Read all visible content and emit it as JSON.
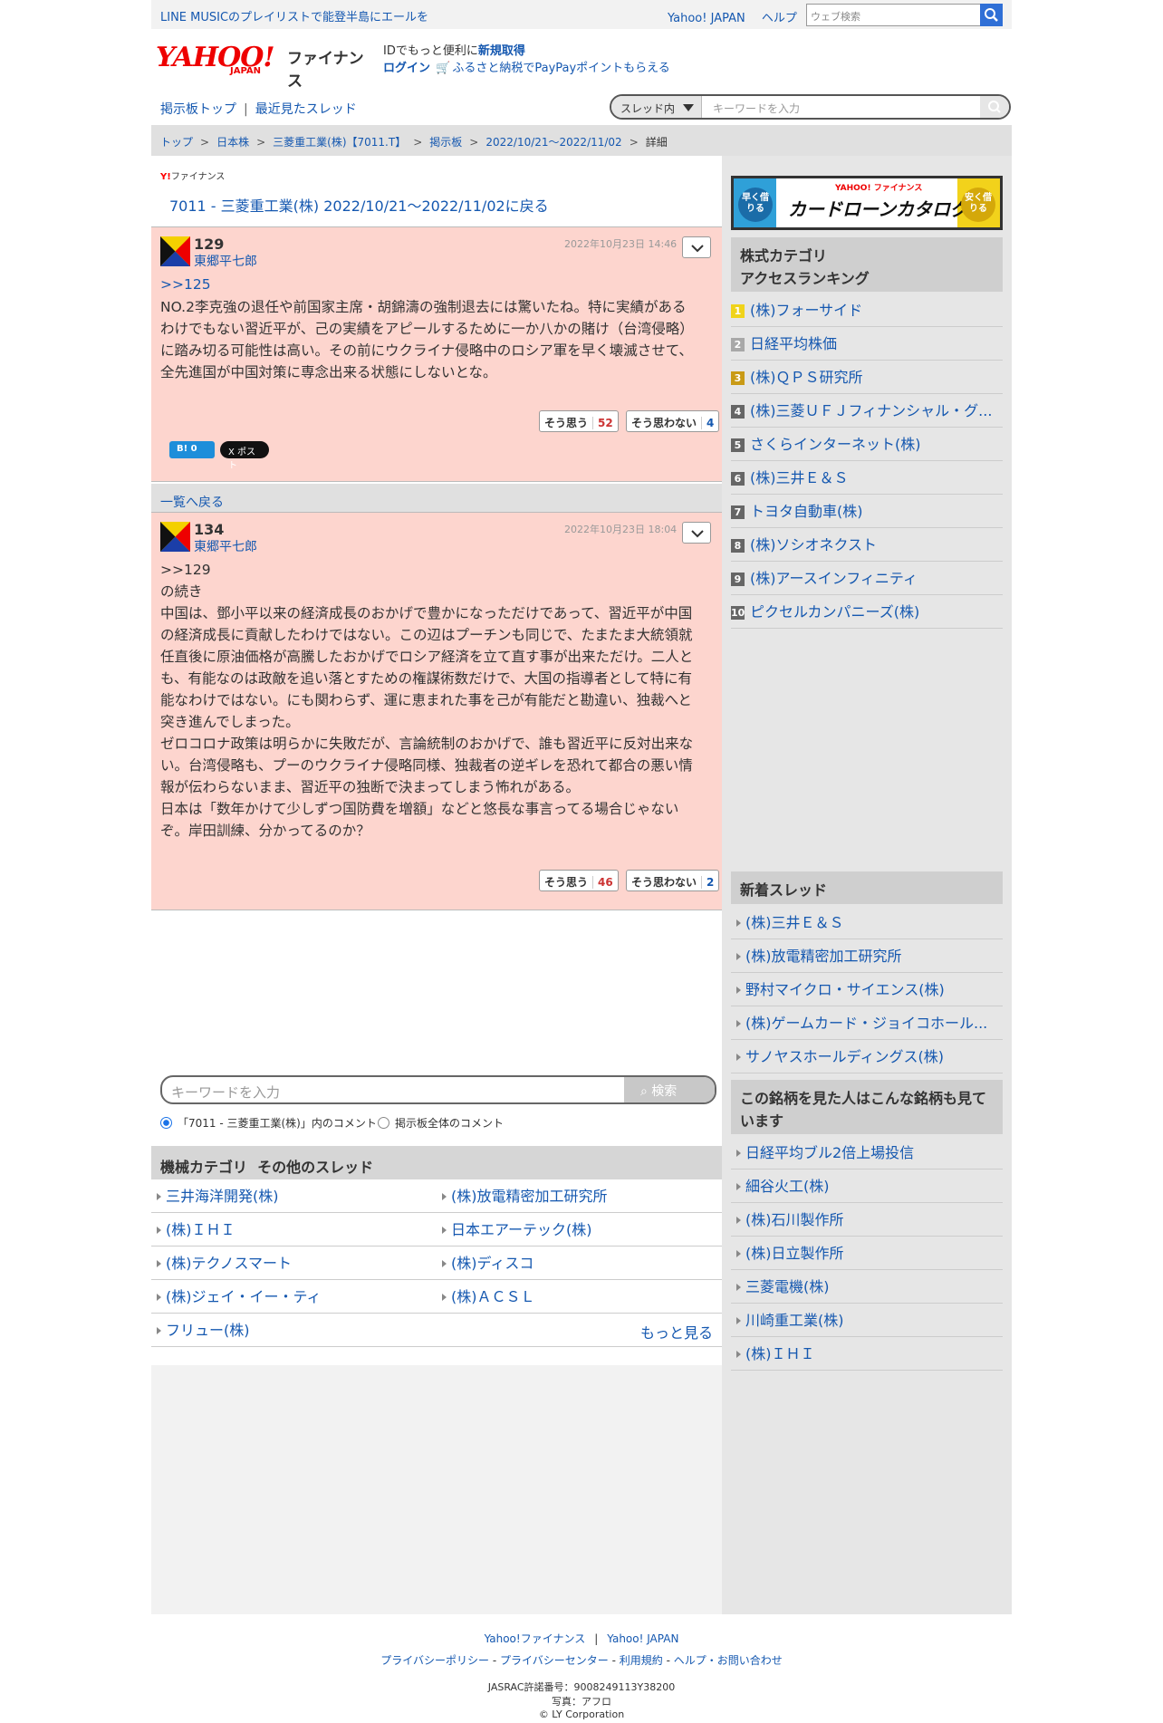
{
  "topbar": {
    "promo": "LINE MUSICのプレイリストで能登半島にエールを",
    "links": [
      "Yahoo! JAPAN",
      "ヘルプ"
    ],
    "search_placeholder": "ウェブ検索"
  },
  "header": {
    "logo_text": "YAHOO!",
    "logo_sub": "JAPAN",
    "service": "ファイナンス",
    "id_prefix": "IDでもっと便利に",
    "id_link": "新規取得",
    "login": "ログイン",
    "furusato": "ふるさと納税でPayPayポイントもらえる"
  },
  "subnav": {
    "board_top": "掲示板トップ",
    "recent": "最近見たスレッド",
    "scope": "スレッド内",
    "keyword_placeholder": "キーワードを入力"
  },
  "breadcrumb": [
    "トップ",
    "日本株",
    "三菱重工業(株)【7011.T】",
    "掲示板",
    "2022/10/21〜2022/11/02",
    "詳細"
  ],
  "thread": {
    "ylogo": "ファイナンス",
    "back_link": "7011 - 三菱重工業(株) 2022/10/21〜2022/11/02に戻る"
  },
  "posts": [
    {
      "number": "129",
      "author": "東郷平七郎",
      "date": "2022年10月23日 14:46",
      "reply": ">>125",
      "body": "NO.2李克強の退任や前国家主席・胡錦濤の強制退去には驚いたね。特に実績がある\nわけでもない習近平が、己の実績をアピールするために一か八かの賭け（台湾侵略）\nに踏み切る可能性は高い。その前にウクライナ侵略中のロシア軍を早く壊滅させて、\n全先進国が中国対策に専念出来る状態にしないとな。",
      "agree_label": "そう思う",
      "agree": "52",
      "disagree_label": "そう思わない",
      "disagree": "4",
      "hatena": "B! 0",
      "xpost": "X ポスト"
    },
    {
      "number": "134",
      "author": "東郷平七郎",
      "date": "2022年10月23日 18:04",
      "body": ">>129\nの続き\n中国は、鄧小平以来の経済成長のおかげで豊かになっただけであって、習近平が中国\nの経済成長に貢献したわけではない。この辺はプーチンも同じで、たまたま大統領就\n任直後に原油価格が高騰したおかげでロシア経済を立て直す事が出来ただけ。二人と\nも、有能なのは政敵を追い落とすための権謀術数だけで、大国の指導者として特に有\n能なわけではない。にも関わらず、運に恵まれた事を己が有能だと勘違い、独裁へと\n突き進んでしまった。\nゼロコロナ政策は明らかに失敗だが、言論統制のおかげで、誰も習近平に反対出来な\nい。台湾侵略も、プーのウクライナ侵略同様、独裁者の逆ギレを恐れて都合の悪い情\n報が伝わらないまま、習近平の独断で決まってしまう怖れがある。\n日本は「数年かけて少しずつ国防費を増額」などと悠長な事言ってる場合じゃない\nぞ。岸田訓練、分かってるのか？",
      "agree_label": "そう思う",
      "agree": "46",
      "disagree_label": "そう思わない",
      "disagree": "2"
    }
  ],
  "list_back": "一覧へ戻る",
  "bottom_search": {
    "placeholder": "キーワードを入力",
    "button": "検索",
    "radio_thread": "「7011 - 三菱重工業(株)」内のコメント",
    "radio_all": "掲示板全体のコメント"
  },
  "other_threads": {
    "title": "機械カテゴリ  その他のスレッド",
    "items": [
      "三井海洋開発(株)",
      "(株)放電精密加工研究所",
      "(株)ＩＨＩ",
      "日本エアーテック(株)",
      "(株)テクノスマート",
      "(株)ディスコ",
      "(株)ジェイ・イー・ティ",
      "(株)ＡＣＳＬ",
      "フリュー(株)"
    ],
    "more": "もっと見る"
  },
  "ad": {
    "title": "カードローンカタログ",
    "brand": "YAHOO! ファイナンス",
    "left": "早く借りる",
    "right": "安く借りる"
  },
  "ranking": {
    "title": "株式カテゴリ\nアクセスランキング",
    "items": [
      "(株)フォーサイド",
      "日経平均株価",
      "(株)ＱＰＳ研究所",
      "(株)三菱ＵＦＪフィナンシャル・グ...",
      "さくらインターネット(株)",
      "(株)三井Ｅ＆Ｓ",
      "トヨタ自動車(株)",
      "(株)ソシオネクスト",
      "(株)アースインフィニティ",
      "ピクセルカンパニーズ(株)"
    ]
  },
  "new_threads": {
    "title": "新着スレッド",
    "items": [
      "(株)三井Ｅ＆Ｓ",
      "(株)放電精密加工研究所",
      "野村マイクロ・サイエンス(株)",
      "(株)ゲームカード・ジョイコホール...",
      "サノヤスホールディングス(株)"
    ]
  },
  "also_viewed": {
    "title": "この銘柄を見た人はこんな銘柄も見ています",
    "items": [
      "日経平均ブル2倍上場投信",
      "細谷火工(株)",
      "(株)石川製作所",
      "(株)日立製作所",
      "三菱電機(株)",
      "川崎重工業(株)",
      "(株)ＩＨＩ"
    ]
  },
  "footer": {
    "links1": [
      "Yahoo!ファイナンス",
      "Yahoo! JAPAN"
    ],
    "links2": [
      "プライバシーポリシー",
      "プライバシーセンター",
      "利用規約",
      "ヘルプ・お問い合わせ"
    ],
    "jasrac": "JASRAC許諾番号：9008249113Y38200",
    "photo": "写真：アフロ",
    "copyright": "© LY Corporation"
  }
}
